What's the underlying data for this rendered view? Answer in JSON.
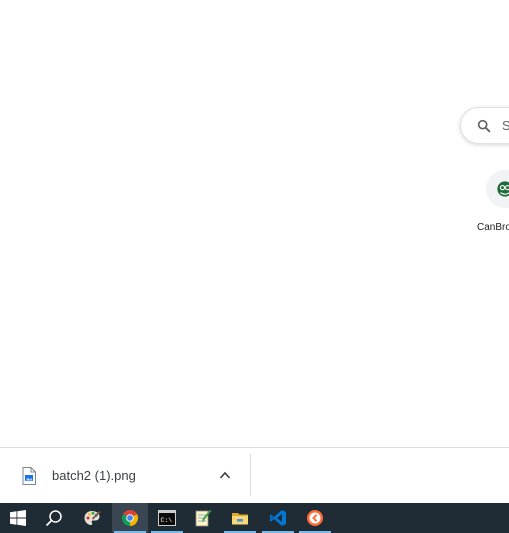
{
  "newtab": {
    "search_placeholder": "S",
    "shortcuts": [
      {
        "label": "CanBro",
        "icon": "canbro-app-icon"
      }
    ]
  },
  "download_shelf": {
    "items": [
      {
        "file_name": "batch2 (1).png",
        "icon": "image-file-icon"
      }
    ]
  },
  "taskbar": {
    "background": "#1f2b35",
    "accent": "#76b9ed",
    "apps": [
      {
        "name": "start",
        "icon": "windows-logo-icon",
        "active": false,
        "running": false
      },
      {
        "name": "search",
        "icon": "search-icon",
        "active": false,
        "running": false
      },
      {
        "name": "paint",
        "icon": "paint-palette-icon",
        "active": false,
        "running": false
      },
      {
        "name": "chrome",
        "icon": "chrome-icon",
        "active": true,
        "running": true
      },
      {
        "name": "terminal",
        "icon": "command-prompt-icon",
        "active": false,
        "running": true
      },
      {
        "name": "notepad",
        "icon": "notepad-icon",
        "active": false,
        "running": false
      },
      {
        "name": "explorer",
        "icon": "folder-icon",
        "active": false,
        "running": true
      },
      {
        "name": "vscode",
        "icon": "vscode-icon",
        "active": false,
        "running": true
      },
      {
        "name": "app",
        "icon": "orange-circle-app-icon",
        "active": false,
        "running": true
      }
    ]
  }
}
